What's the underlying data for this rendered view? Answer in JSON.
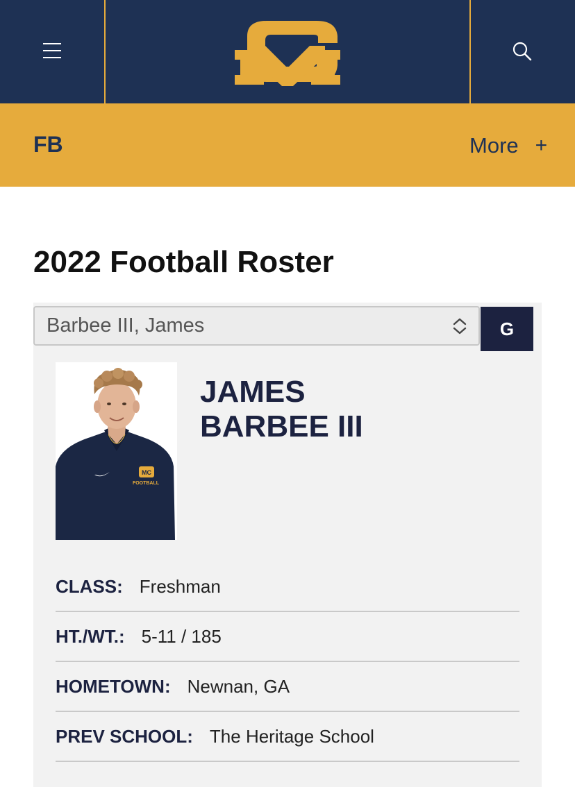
{
  "header": {
    "menu_icon": "hamburger-icon",
    "logo_icon": "mc-logo",
    "logo_letters": "MC",
    "search_icon": "search-icon",
    "colors": {
      "navy": "#1e3154",
      "gold": "#e6ab3c",
      "dark_navy": "#1c2240"
    }
  },
  "subnav": {
    "sport": "FB",
    "more_label": "More",
    "more_icon": "plus-icon"
  },
  "page": {
    "title": "2022 Football Roster"
  },
  "player_select": {
    "value": "Barbee III, James",
    "go_label": "G"
  },
  "player": {
    "first_name": "JAMES",
    "last_name": "BARBEE III",
    "photo_shirt_text": "FOOTBALL",
    "details": [
      {
        "label": "CLASS:",
        "value": "Freshman"
      },
      {
        "label": "HT./WT.:",
        "value": "5-11 / 185"
      },
      {
        "label": "HOMETOWN:",
        "value": "Newnan, GA"
      },
      {
        "label": "PREV SCHOOL:",
        "value": "The Heritage School"
      }
    ]
  }
}
